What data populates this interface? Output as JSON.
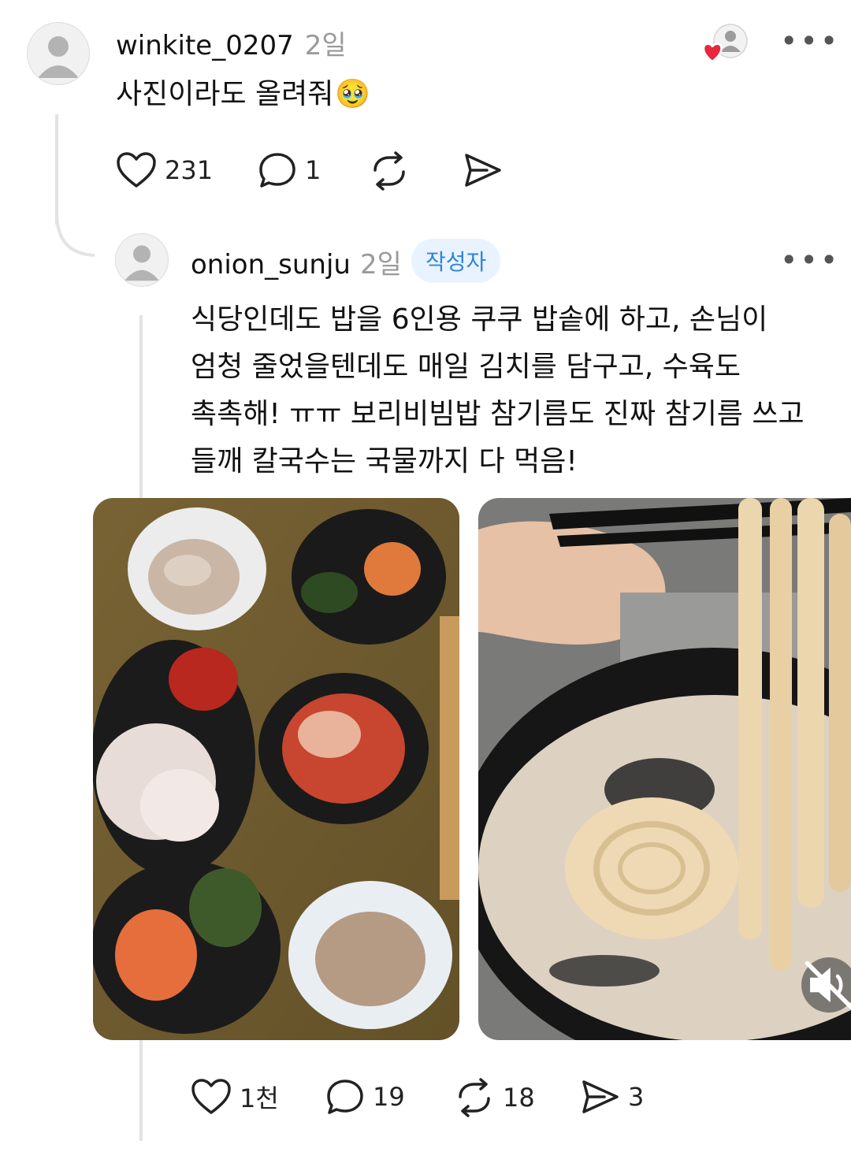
{
  "comment1": {
    "username": "winkite_0207",
    "time": "2일",
    "text": "사진이라도 올려줘",
    "emoji": "🥹",
    "likes": "231",
    "replies": "1"
  },
  "reply": {
    "username": "onion_sunju",
    "time": "2일",
    "author_badge": "작성자",
    "text_lines": [
      "식당인데도 밥을 6인용 쿠쿠 밥솥에 하고, 손님이",
      "엄청 줄었을텐데도 매일 김치를 담구고, 수육도",
      "촉촉해! ㅠㅠ 보리비빔밥 참기름도 진짜 참기름 쓰고",
      "들깨 칼국수는 국물까지 다 먹음!"
    ],
    "likes": "1천",
    "replies": "19",
    "reposts": "18",
    "shares": "3"
  },
  "icons": {
    "heart": "heart-icon",
    "comment": "comment-icon",
    "repost": "repost-icon",
    "share": "send-icon",
    "more": "more-icon",
    "mute": "speaker-muted-icon",
    "liked_by_author": "author-liked-icon"
  },
  "colors": {
    "badge_bg": "#e9f3ff",
    "badge_text": "#2f86d6",
    "like_red": "#e8263d"
  }
}
